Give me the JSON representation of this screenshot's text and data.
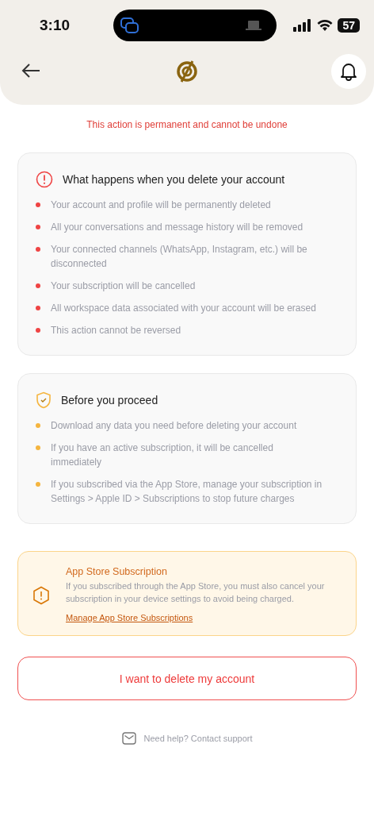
{
  "status_bar": {
    "time": "3:10",
    "battery": "57"
  },
  "subtitle": "This action is permanent and cannot be undone",
  "sections": [
    {
      "kind": "alert",
      "color": "#ef4444",
      "title": "What happens when you delete your account",
      "items": [
        "Your account and profile will be permanently deleted",
        "All your conversations and message history will be removed",
        "Your connected channels (WhatsApp, Instagram, etc.) will be disconnected",
        "Your subscription will be cancelled",
        "All workspace data associated with your account will be erased",
        "This action cannot be reversed"
      ]
    },
    {
      "kind": "shield",
      "color": "#f5b53f",
      "title": "Before you proceed",
      "items": [
        "Download any data you need before deleting your account",
        "If you have an active subscription, it will be cancelled immediately",
        "If you subscribed via the App Store, manage your subscription in Settings > Apple ID > Subscriptions to stop future charges"
      ]
    }
  ],
  "notice": {
    "title": "App Store Subscription",
    "text": "If you subscribed through the App Store, you must also cancel your subscription in your device settings to avoid being charged.",
    "link": "Manage App Store Subscriptions"
  },
  "delete_button": "I want to delete my account",
  "footer": "Need help? Contact support"
}
